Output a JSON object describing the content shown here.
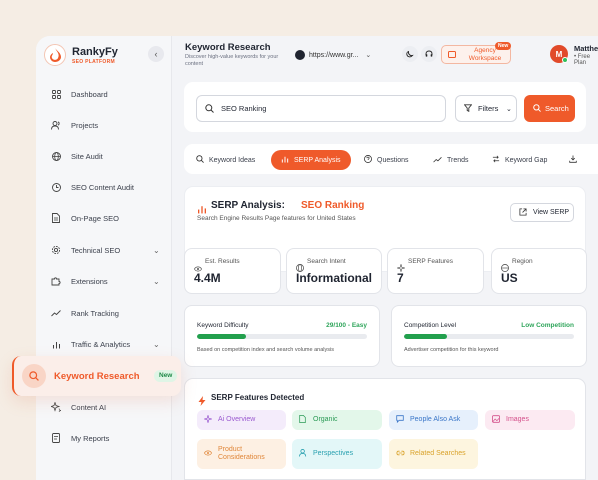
{
  "brand": {
    "name": "RankyFy",
    "subtitle": "SEO PLATFORM",
    "accent": "#ef5a2a"
  },
  "sidebar": {
    "items": [
      {
        "label": "Dashboard",
        "icon": "grid-icon"
      },
      {
        "label": "Projects",
        "icon": "users-icon"
      },
      {
        "label": "Site Audit",
        "icon": "globe-icon"
      },
      {
        "label": "SEO Content Audit",
        "icon": "clock-icon"
      },
      {
        "label": "On-Page SEO",
        "icon": "document-icon"
      },
      {
        "label": "Technical SEO",
        "icon": "gear-icon"
      },
      {
        "label": "Extensions",
        "icon": "puzzle-icon"
      },
      {
        "label": "Rank Tracking",
        "icon": "trend-icon"
      },
      {
        "label": "Traffic & Analytics",
        "icon": "chart-icon"
      },
      {
        "label": "Content AI",
        "icon": "sparkle-icon"
      },
      {
        "label": "My Reports",
        "icon": "report-icon"
      }
    ],
    "active": {
      "label": "Keyword Research",
      "badge": "New",
      "icon": "search-icon"
    }
  },
  "header": {
    "title": "Keyword Research",
    "subtitle": "Discover high-value keywords for your content",
    "url": "https://www.gr...",
    "agency": {
      "label": "Agency Workspace",
      "badge": "New"
    },
    "user": {
      "initial": "M",
      "name": "Matthew",
      "plan": "• Free Plan"
    }
  },
  "search": {
    "value": "SEO Ranking",
    "filters_label": "Filters",
    "button_label": "Search"
  },
  "tabs": [
    "Keyword Ideas",
    "SERP Analysis",
    "Questions",
    "Trends",
    "Keyword Gap"
  ],
  "serp": {
    "title": "SERP Analysis:",
    "keyword": "SEO Ranking",
    "subtitle": "Search Engine Results Page features for United States",
    "view_label": "View SERP"
  },
  "stats": [
    {
      "label": "Est. Results",
      "value": "4.4M"
    },
    {
      "label": "Search Intent",
      "value": "Informational"
    },
    {
      "label": "SERP Features",
      "value": "7"
    },
    {
      "label": "Region",
      "value": "US"
    }
  ],
  "metrics": [
    {
      "label": "Keyword Difficulty",
      "value": "29/100 - Easy",
      "fill_percent": 29,
      "sub": "Based on competition index and search volume analysis"
    },
    {
      "label": "Competition Level",
      "value": "Low Competition",
      "fill_percent": 25,
      "sub": "Advertiser competition for this keyword"
    }
  ],
  "features": {
    "title": "SERP Features Detected",
    "chips": [
      "Ai Overview",
      "Organic",
      "People Also Ask",
      "Images",
      "Product Considerations",
      "Perspectives",
      "Related Searches"
    ]
  }
}
